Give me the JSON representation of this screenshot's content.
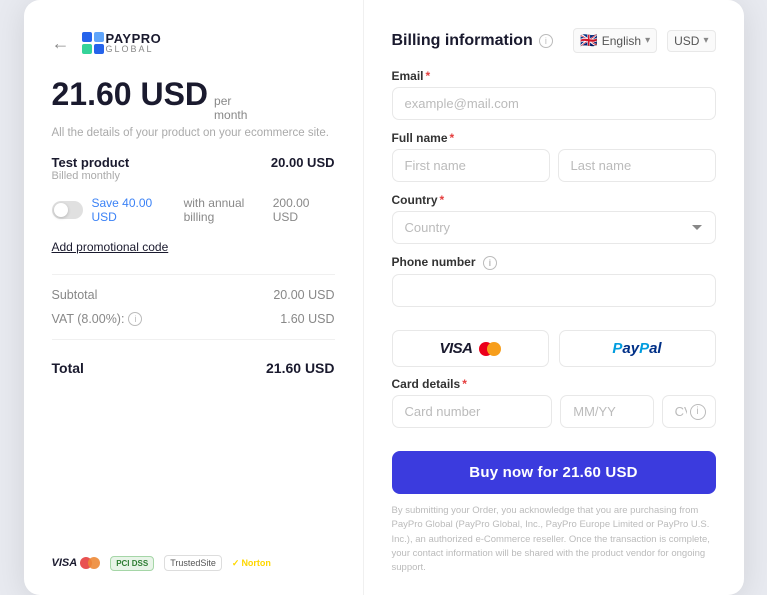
{
  "left": {
    "back_icon": "←",
    "logo_text_paypro": "PAYPRO",
    "logo_text_global": "GLOBAL",
    "price": "21.60 USD",
    "per_month": "per",
    "month_label": "month",
    "product_desc": "All the details of your product on your ecommerce site.",
    "product_name": "Test product",
    "billed_label": "Billed monthly",
    "product_price": "20.00 USD",
    "save_text": "Save 40.00 USD",
    "annual_text": "with annual billing",
    "annual_price": "200.00 USD",
    "promo_link": "Add promotional code",
    "subtotal_label": "Subtotal",
    "subtotal_value": "20.00 USD",
    "vat_label": "VAT (8.00%):",
    "vat_value": "1.60 USD",
    "total_label": "Total",
    "total_value": "21.60 USD",
    "badge_visa": "VISA",
    "badge_pci": "PCI DSS",
    "badge_trusted": "TrustedSite",
    "badge_norton": "Norton"
  },
  "right": {
    "title": "Billing information",
    "lang": "English",
    "currency": "USD",
    "flag": "🇬🇧",
    "email_label": "Email",
    "email_placeholder": "example@mail.com",
    "fullname_label": "Full name",
    "firstname_placeholder": "First name",
    "lastname_placeholder": "Last name",
    "country_label": "Country",
    "country_placeholder": "Country",
    "phone_label": "Phone number",
    "phone_placeholder": "",
    "card_label": "Card details",
    "card_number_placeholder": "Card number",
    "card_exp_placeholder": "MM/YY",
    "card_cvc_placeholder": "CVC",
    "buy_button": "Buy now for 21.60 USD",
    "terms": "By submitting your Order, you acknowledge that you are purchasing from PayPro Global (PayPro Global, Inc., PayPro Europe Limited or PayPro U.S. Inc.), an authorized e-Commerce reseller. Once the transaction is complete, your contact information will be shared with the product vendor for ongoing support."
  }
}
